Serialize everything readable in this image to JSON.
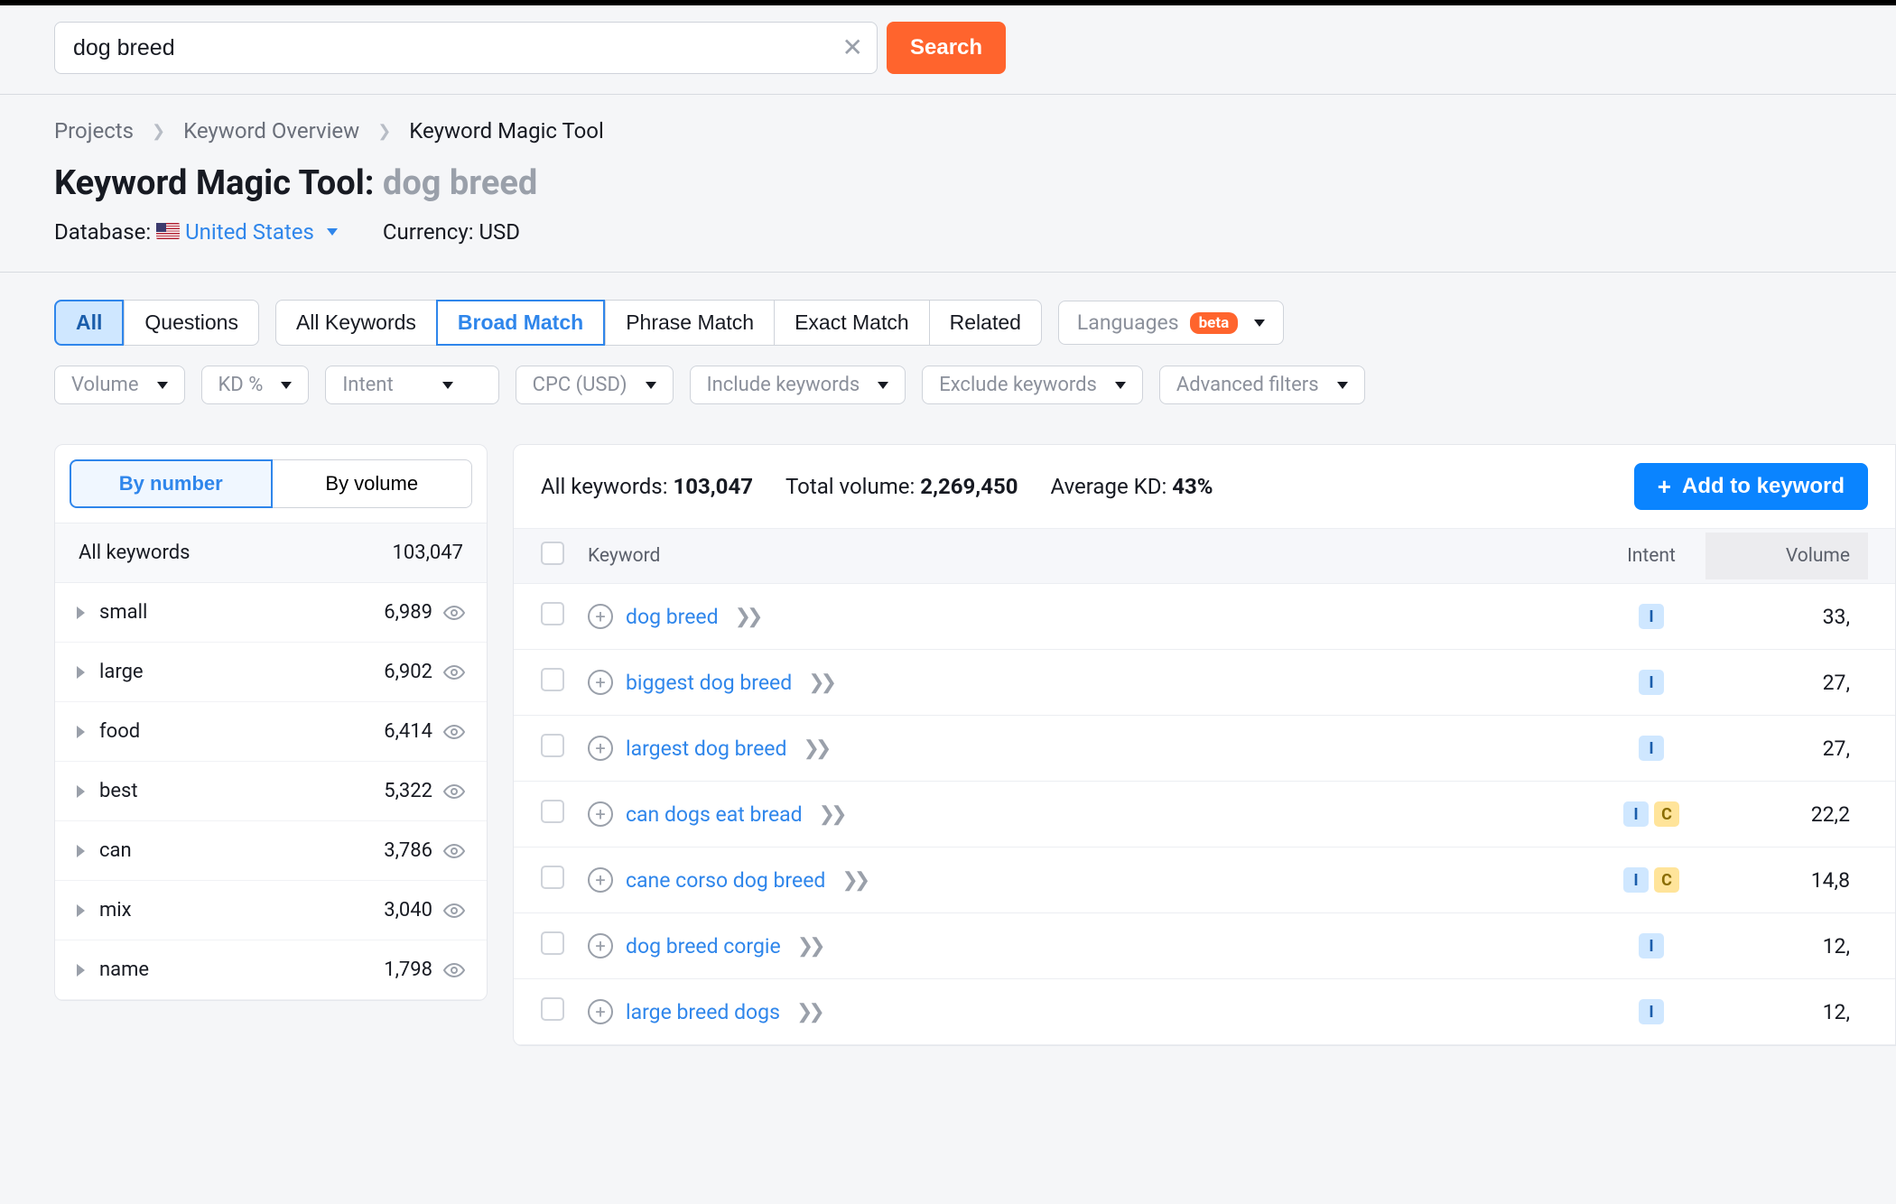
{
  "search": {
    "value": "dog breed",
    "button": "Search"
  },
  "breadcrumb": {
    "items": [
      "Projects",
      "Keyword Overview",
      "Keyword Magic Tool"
    ]
  },
  "title": {
    "prefix": "Keyword Magic Tool:",
    "query": "dog breed"
  },
  "meta": {
    "database_label": "Database:",
    "database_value": "United States",
    "currency_label": "Currency:",
    "currency_value": "USD"
  },
  "tabs1": {
    "all": "All",
    "questions": "Questions"
  },
  "tabs2": {
    "all_kw": "All Keywords",
    "broad": "Broad Match",
    "phrase": "Phrase Match",
    "exact": "Exact Match",
    "related": "Related"
  },
  "languages": {
    "label": "Languages",
    "badge": "beta"
  },
  "filters": {
    "volume": "Volume",
    "kd": "KD %",
    "intent": "Intent",
    "cpc": "CPC (USD)",
    "include": "Include keywords",
    "exclude": "Exclude keywords",
    "advanced": "Advanced filters"
  },
  "sidebar": {
    "by_number": "By number",
    "by_volume": "By volume",
    "all_label": "All keywords",
    "all_count": "103,047",
    "groups": [
      {
        "name": "small",
        "count": "6,989"
      },
      {
        "name": "large",
        "count": "6,902"
      },
      {
        "name": "food",
        "count": "6,414"
      },
      {
        "name": "best",
        "count": "5,322"
      },
      {
        "name": "can",
        "count": "3,786"
      },
      {
        "name": "mix",
        "count": "3,040"
      },
      {
        "name": "name",
        "count": "1,798"
      }
    ]
  },
  "summary": {
    "all_label": "All keywords:",
    "all_value": "103,047",
    "vol_label": "Total volume:",
    "vol_value": "2,269,450",
    "kd_label": "Average KD:",
    "kd_value": "43%",
    "add_btn": "Add to keyword"
  },
  "table": {
    "headers": {
      "keyword": "Keyword",
      "intent": "Intent",
      "volume": "Volume"
    },
    "rows": [
      {
        "keyword": "dog breed",
        "intents": [
          "I"
        ],
        "volume": "33,"
      },
      {
        "keyword": "biggest dog breed",
        "intents": [
          "I"
        ],
        "volume": "27,"
      },
      {
        "keyword": "largest dog breed",
        "intents": [
          "I"
        ],
        "volume": "27,"
      },
      {
        "keyword": "can dogs eat bread",
        "intents": [
          "I",
          "C"
        ],
        "volume": "22,2"
      },
      {
        "keyword": "cane corso dog breed",
        "intents": [
          "I",
          "C"
        ],
        "volume": "14,8"
      },
      {
        "keyword": "dog breed corgie",
        "intents": [
          "I"
        ],
        "volume": "12,"
      },
      {
        "keyword": "large breed dogs",
        "intents": [
          "I"
        ],
        "volume": "12,"
      }
    ]
  }
}
